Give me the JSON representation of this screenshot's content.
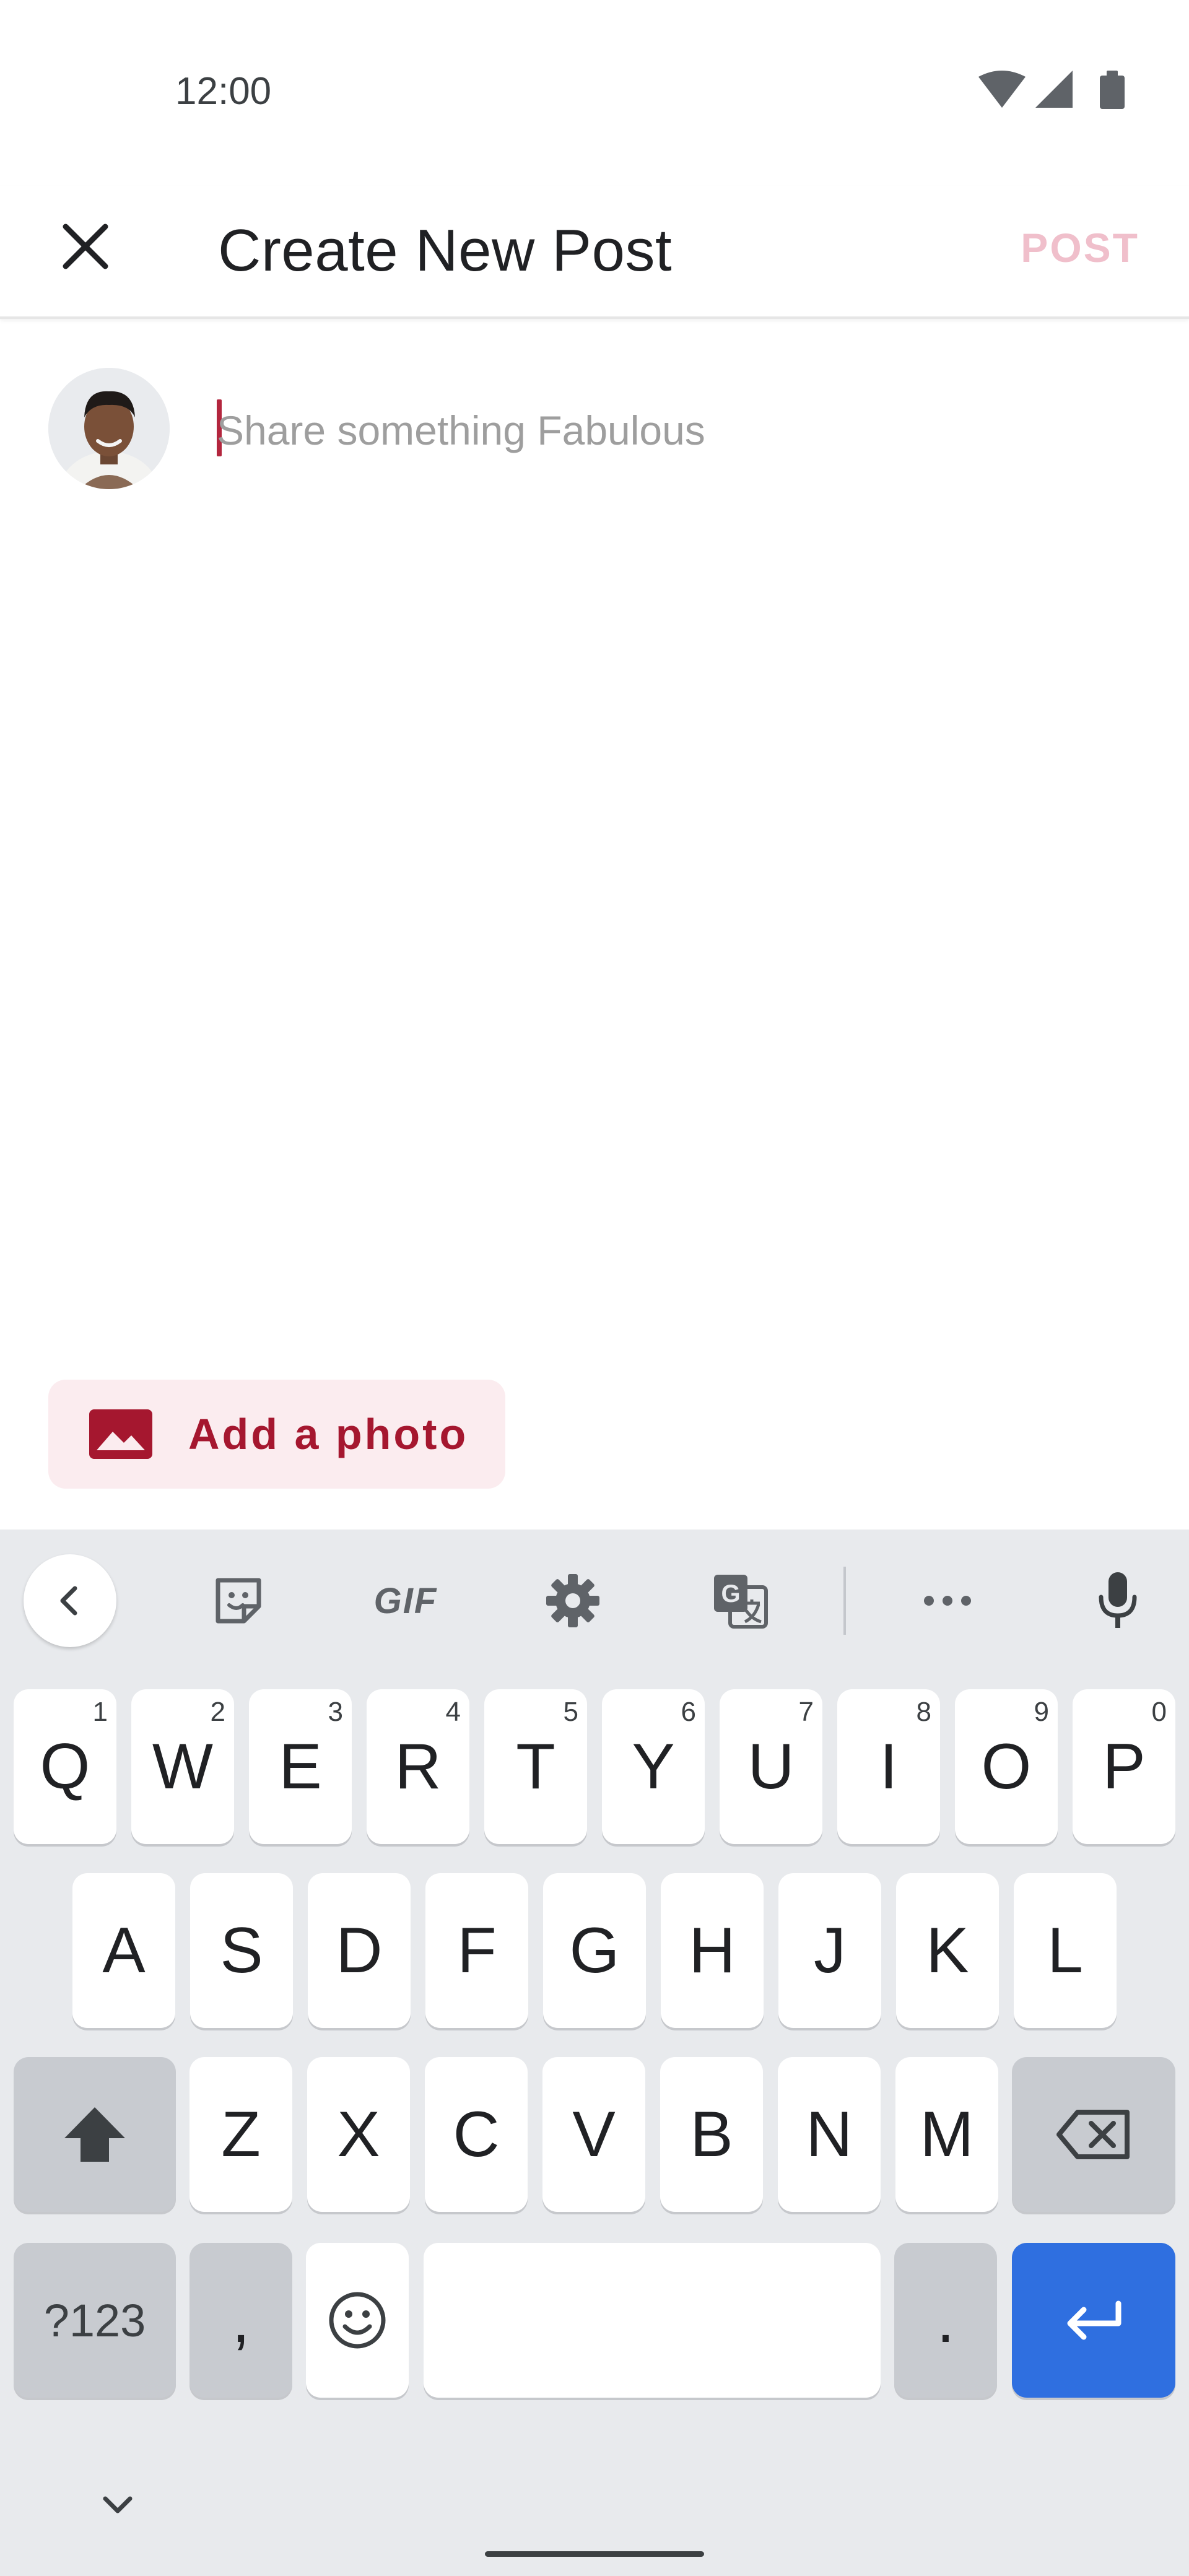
{
  "status_bar": {
    "time": "12:00",
    "icons": [
      "wifi-icon",
      "signal-icon",
      "battery-icon"
    ]
  },
  "app_bar": {
    "close_icon": "close-icon",
    "title": "Create New Post",
    "post_label": "POST"
  },
  "composer": {
    "avatar": "user-avatar",
    "placeholder": "Share something Fabulous",
    "value": ""
  },
  "add_photo": {
    "icon": "image-icon",
    "label": "Add a photo"
  },
  "keyboard": {
    "toolbar": {
      "back_icon": "chevron-left-icon",
      "sticker_icon": "sticker-icon",
      "gif_label": "GIF",
      "settings_icon": "gear-icon",
      "translate_icon": "translate-icon",
      "more_icon": "more-horizontal-icon",
      "mic_icon": "microphone-icon"
    },
    "row1": [
      {
        "label": "Q",
        "hint": "1"
      },
      {
        "label": "W",
        "hint": "2"
      },
      {
        "label": "E",
        "hint": "3"
      },
      {
        "label": "R",
        "hint": "4"
      },
      {
        "label": "T",
        "hint": "5"
      },
      {
        "label": "Y",
        "hint": "6"
      },
      {
        "label": "U",
        "hint": "7"
      },
      {
        "label": "I",
        "hint": "8"
      },
      {
        "label": "O",
        "hint": "9"
      },
      {
        "label": "P",
        "hint": "0"
      }
    ],
    "row2": [
      "A",
      "S",
      "D",
      "F",
      "G",
      "H",
      "J",
      "K",
      "L"
    ],
    "row3": [
      "Z",
      "X",
      "C",
      "V",
      "B",
      "N",
      "M"
    ],
    "symbols_label": "?123",
    "comma_label": ",",
    "period_label": ".",
    "shift_icon": "shift-icon",
    "backspace_icon": "backspace-icon",
    "emoji_icon": "emoji-icon",
    "enter_icon": "enter-icon",
    "hide_icon": "chevron-down-icon"
  },
  "colors": {
    "accent": "#a5172f",
    "post_disabled": "#f0bfcb",
    "add_photo_bg": "#fbecef",
    "enter_key": "#2f6fe0",
    "keyboard_bg": "#e8eaed"
  }
}
